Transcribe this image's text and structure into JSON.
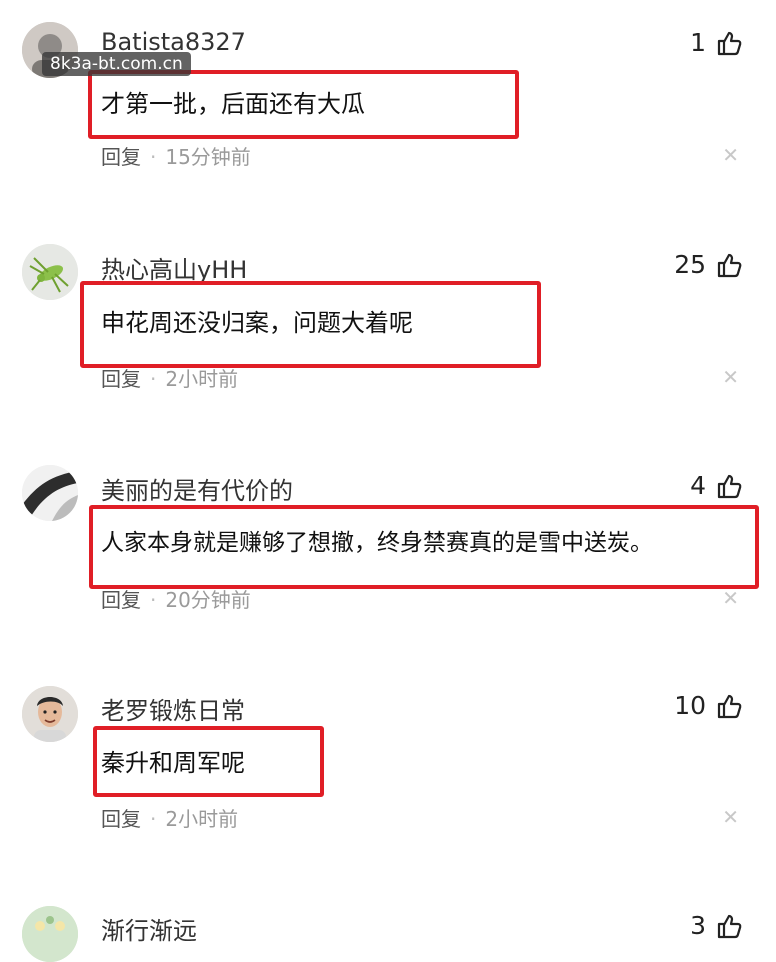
{
  "watermark": "8k3a-bt.com.cn",
  "comments": [
    {
      "username": "Batista8327",
      "likes": "1",
      "text": "才第一批，后面还有大瓜",
      "reply": "回复",
      "time": "15分钟前",
      "avatar_icon": "avatar-icon"
    },
    {
      "username": "热心高山yHH",
      "likes": "25",
      "text": "申花周还没归案，问题大着呢",
      "reply": "回复",
      "time": "2小时前",
      "avatar_icon": "grasshopper-avatar-icon"
    },
    {
      "username": "美丽的是有代价的",
      "likes": "4",
      "text": "人家本身就是赚够了想撤，终身禁赛真的是雪中送炭。",
      "reply": "回复",
      "time": "20分钟前",
      "avatar_icon": "abstract-avatar-icon"
    },
    {
      "username": "老罗锻炼日常",
      "likes": "10",
      "text": "秦升和周军呢",
      "reply": "回复",
      "time": "2小时前",
      "avatar_icon": "portrait-avatar-icon"
    },
    {
      "username": "渐行渐远",
      "likes": "3",
      "avatar_icon": "green-avatar-icon"
    }
  ],
  "icons": {
    "like": "thumbs-up-icon",
    "close": "close-icon"
  },
  "colors": {
    "highlight": "#e01e26",
    "meta": "#9a9a9a"
  }
}
